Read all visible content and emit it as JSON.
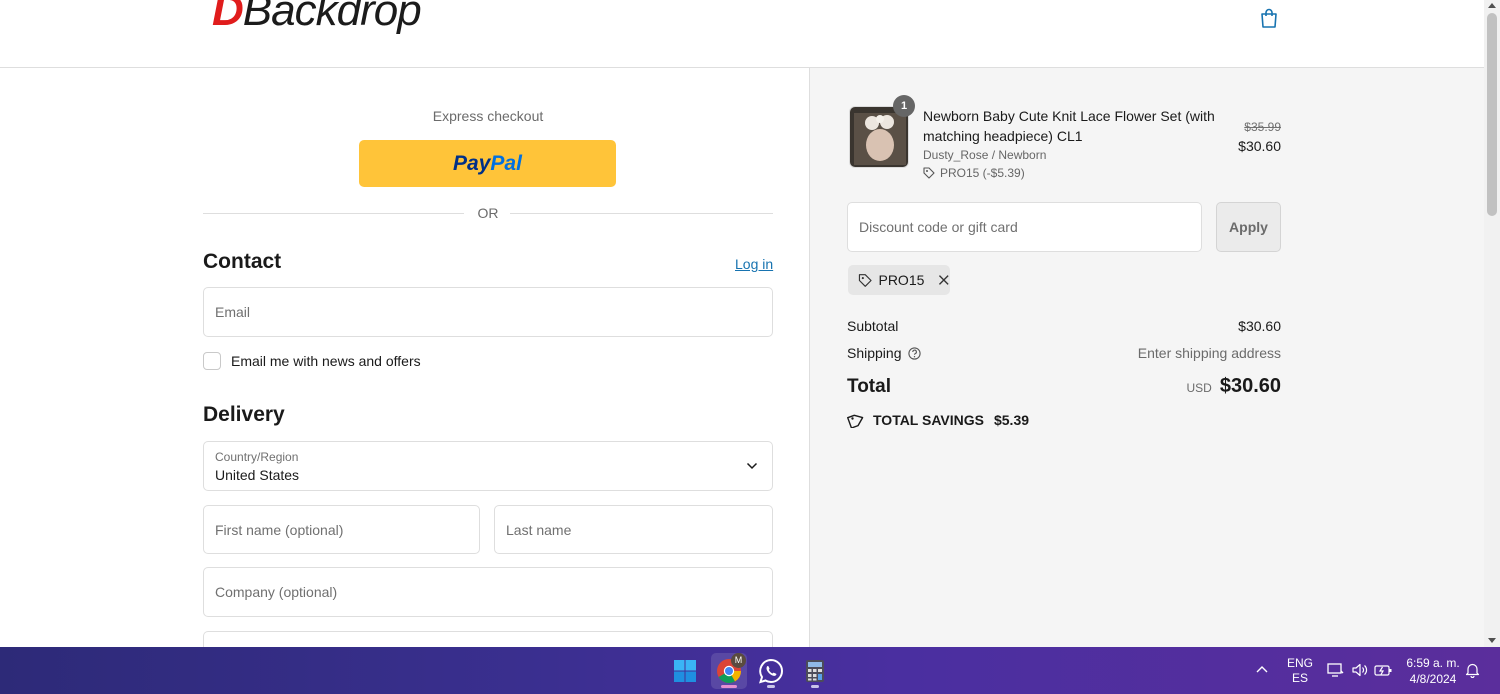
{
  "header": {
    "logo_letter": "D",
    "logo_rest": "Backdrop",
    "cart_icon": "shopping-bag-icon"
  },
  "express": {
    "label": "Express checkout",
    "paypal_part1": "Pay",
    "paypal_part2": "Pal",
    "or_text": "OR"
  },
  "contact": {
    "title": "Contact",
    "login_link": "Log in",
    "email_placeholder": "Email",
    "newsletter_label": "Email me with news and offers"
  },
  "delivery": {
    "title": "Delivery",
    "country_label": "Country/Region",
    "country_value": "United States",
    "first_name_placeholder": "First name (optional)",
    "last_name_placeholder": "Last name",
    "company_placeholder": "Company (optional)"
  },
  "summary": {
    "product": {
      "quantity": "1",
      "name": "Newborn Baby Cute Knit Lace Flower Set (with matching headpiece) CL1",
      "variant": "Dusty_Rose / Newborn",
      "discount_line": "PRO15 (-$5.39)",
      "original_price": "$35.99",
      "price": "$30.60"
    },
    "discount_placeholder": "Discount code or gift card",
    "apply_label": "Apply",
    "applied_code": "PRO15",
    "subtotal_label": "Subtotal",
    "subtotal_value": "$30.60",
    "shipping_label": "Shipping",
    "shipping_value": "Enter shipping address",
    "total_label": "Total",
    "total_currency": "USD",
    "total_value": "$30.60",
    "savings_label": "TOTAL SAVINGS",
    "savings_value": "$5.39"
  },
  "taskbar": {
    "lang_line1": "ENG",
    "lang_line2": "ES",
    "time": "6:59 a. m.",
    "date": "4/8/2024",
    "chrome_badge": "M"
  },
  "colors": {
    "brand_red": "#e01c1c",
    "link_blue": "#1773b0",
    "paypal_yellow": "#ffc439",
    "summary_bg": "#f5f5f5"
  }
}
